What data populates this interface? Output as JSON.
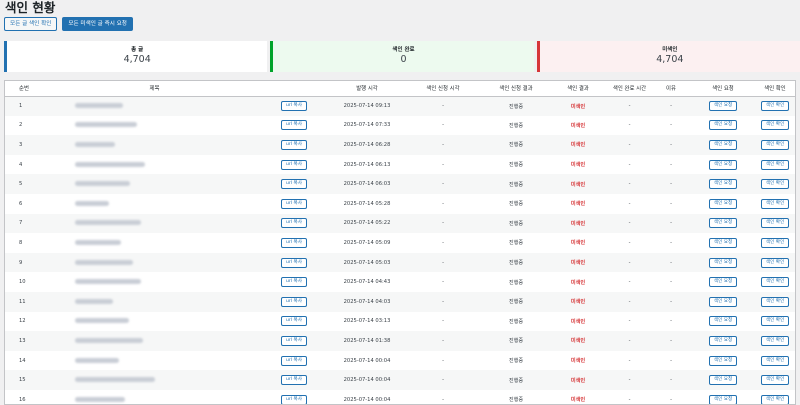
{
  "page": {
    "title": "색인 현황"
  },
  "toolbar": {
    "check_all_label": "모든 글 색인 확인",
    "request_all_label": "모든 미색인 글 즉시 요청"
  },
  "stats": {
    "total": {
      "label": "총 글",
      "value": "4,704"
    },
    "indexed": {
      "label": "색인 완료",
      "value": "0"
    },
    "unindexed": {
      "label": "미색인",
      "value": "4,704"
    }
  },
  "table": {
    "headers": {
      "num": "순번",
      "title": "제목",
      "published": "발행 시각",
      "req_time": "색인 신청 시각",
      "req_result": "색인 신청 결과",
      "index_result": "색인 결과",
      "done_time": "색인 완료 시간",
      "reason": "이유",
      "request": "색인 요청",
      "check": "색인 확인"
    },
    "copy_label": "url 복사",
    "request_label": "색인 요청",
    "check_label": "색인 확인",
    "rows": [
      {
        "num": "1",
        "published": "2025-07-14 09:13",
        "req_time": "-",
        "req_result": "진행중",
        "index_result": "미색인",
        "done_time": "-",
        "reason": "-"
      },
      {
        "num": "2",
        "published": "2025-07-14 07:33",
        "req_time": "-",
        "req_result": "진행중",
        "index_result": "미색인",
        "done_time": "-",
        "reason": "-"
      },
      {
        "num": "3",
        "published": "2025-07-14 06:28",
        "req_time": "-",
        "req_result": "진행중",
        "index_result": "미색인",
        "done_time": "-",
        "reason": "-"
      },
      {
        "num": "4",
        "published": "2025-07-14 06:13",
        "req_time": "-",
        "req_result": "진행중",
        "index_result": "미색인",
        "done_time": "-",
        "reason": "-"
      },
      {
        "num": "5",
        "published": "2025-07-14 06:03",
        "req_time": "-",
        "req_result": "진행중",
        "index_result": "미색인",
        "done_time": "-",
        "reason": "-"
      },
      {
        "num": "6",
        "published": "2025-07-14 05:28",
        "req_time": "-",
        "req_result": "진행중",
        "index_result": "미색인",
        "done_time": "-",
        "reason": "-"
      },
      {
        "num": "7",
        "published": "2025-07-14 05:22",
        "req_time": "-",
        "req_result": "진행중",
        "index_result": "미색인",
        "done_time": "-",
        "reason": "-"
      },
      {
        "num": "8",
        "published": "2025-07-14 05:09",
        "req_time": "-",
        "req_result": "진행중",
        "index_result": "미색인",
        "done_time": "-",
        "reason": "-"
      },
      {
        "num": "9",
        "published": "2025-07-14 05:03",
        "req_time": "-",
        "req_result": "진행중",
        "index_result": "미색인",
        "done_time": "-",
        "reason": "-"
      },
      {
        "num": "10",
        "published": "2025-07-14 04:43",
        "req_time": "-",
        "req_result": "진행중",
        "index_result": "미색인",
        "done_time": "-",
        "reason": "-"
      },
      {
        "num": "11",
        "published": "2025-07-14 04:03",
        "req_time": "-",
        "req_result": "진행중",
        "index_result": "미색인",
        "done_time": "-",
        "reason": "-"
      },
      {
        "num": "12",
        "published": "2025-07-14 03:13",
        "req_time": "-",
        "req_result": "진행중",
        "index_result": "미색인",
        "done_time": "-",
        "reason": "-"
      },
      {
        "num": "13",
        "published": "2025-07-14 01:38",
        "req_time": "-",
        "req_result": "진행중",
        "index_result": "미색인",
        "done_time": "-",
        "reason": "-"
      },
      {
        "num": "14",
        "published": "2025-07-14 00:04",
        "req_time": "-",
        "req_result": "진행중",
        "index_result": "미색인",
        "done_time": "-",
        "reason": "-"
      },
      {
        "num": "15",
        "published": "2025-07-14 00:04",
        "req_time": "-",
        "req_result": "진행중",
        "index_result": "미색인",
        "done_time": "-",
        "reason": "-"
      },
      {
        "num": "16",
        "published": "2025-07-14 00:04",
        "req_time": "-",
        "req_result": "진행중",
        "index_result": "미색인",
        "done_time": "-",
        "reason": "-"
      }
    ]
  },
  "colors": {
    "accent": "#2271b1",
    "indexed": "#00a32a",
    "unindexed": "#d63638"
  }
}
